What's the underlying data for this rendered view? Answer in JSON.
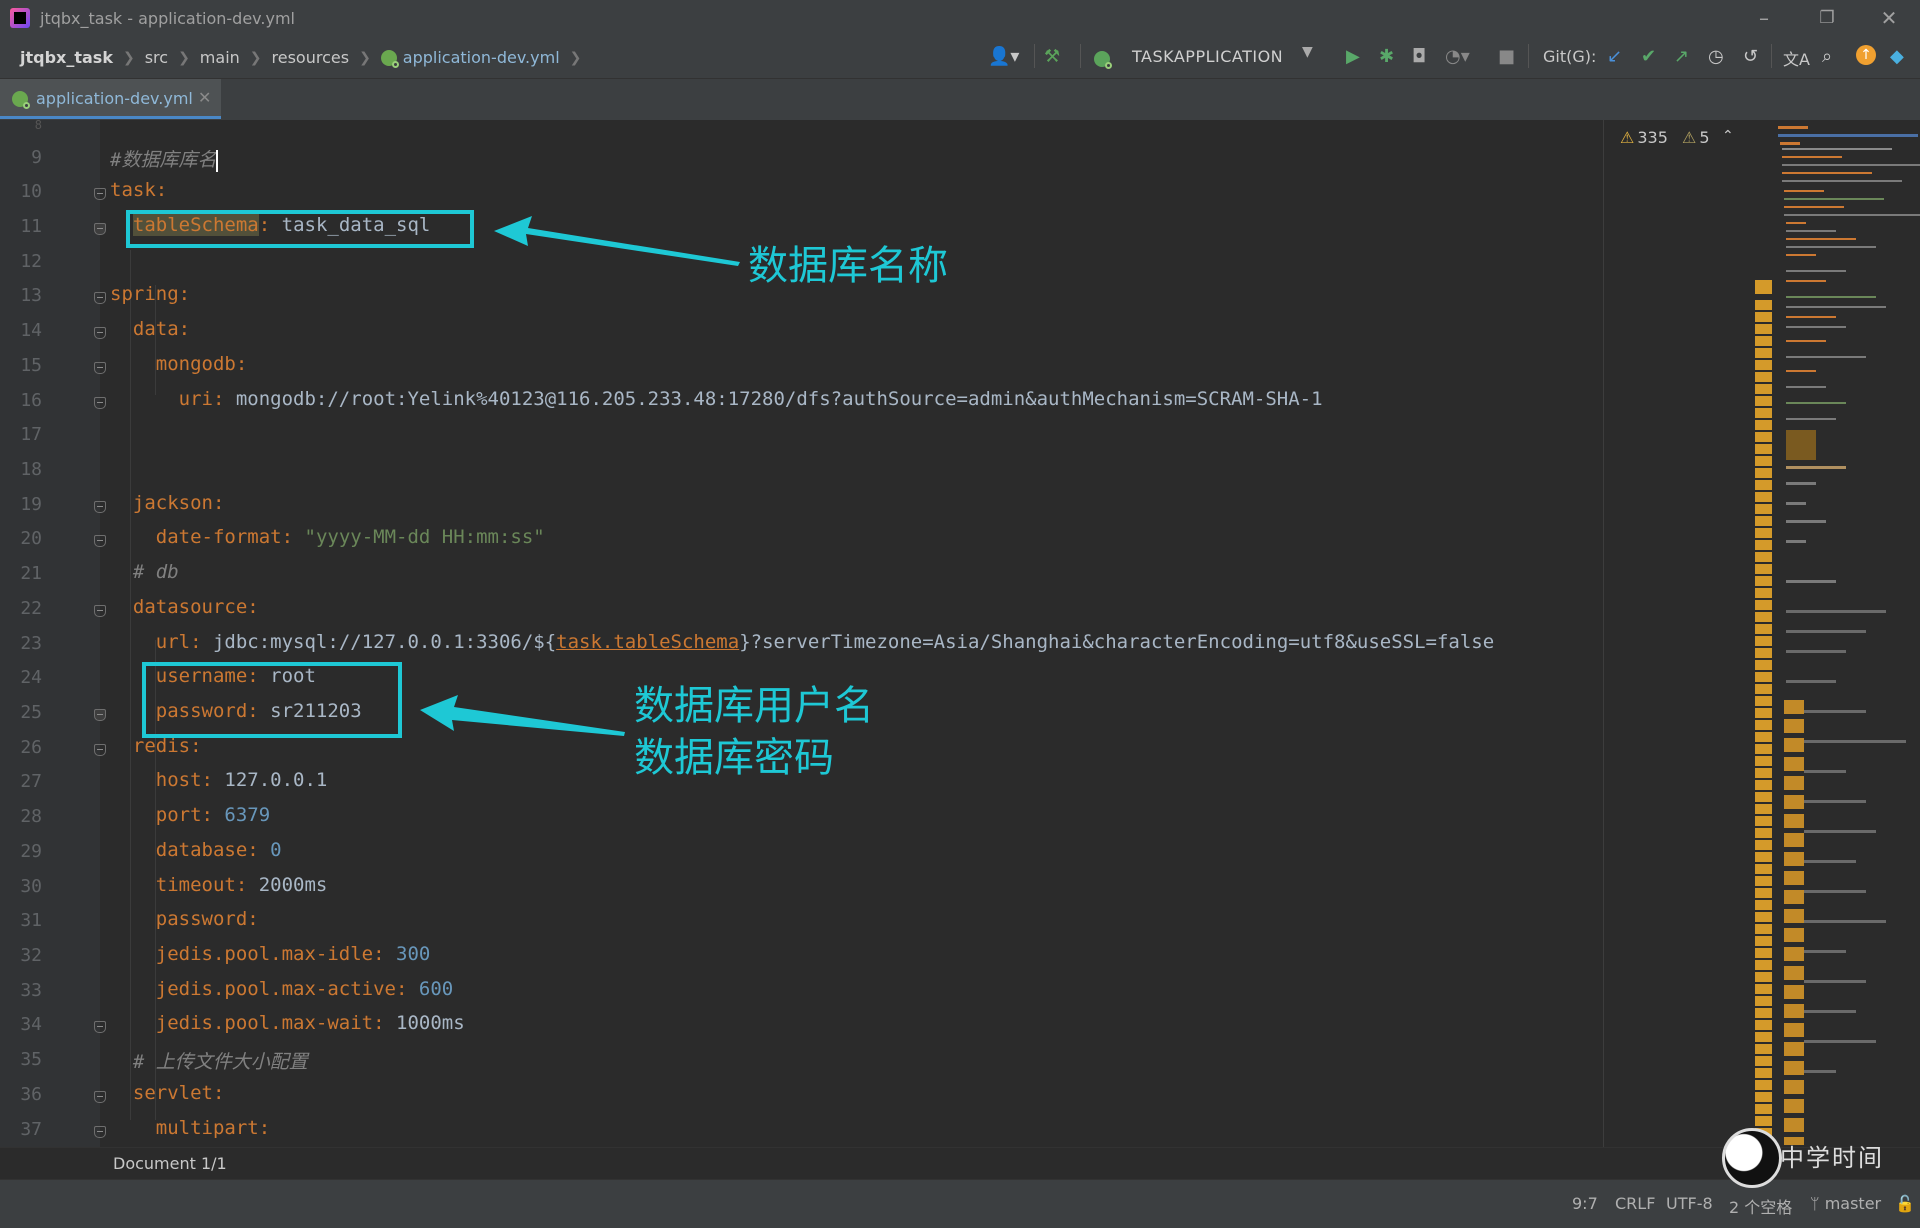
{
  "window": {
    "title": "jtqbx_task - application-dev.yml"
  },
  "breadcrumbs": [
    "jtqbx_task",
    "src",
    "main",
    "resources",
    "application-dev.yml"
  ],
  "toolbar": {
    "run_config": "TASKAPPLICATION",
    "git_label": "Git(G):"
  },
  "tab": {
    "label": "application-dev.yml"
  },
  "inspections": {
    "warnings": "335",
    "weak_warnings": "5"
  },
  "editor": {
    "line_numbers": [
      "9",
      "10",
      "11",
      "12",
      "13",
      "14",
      "15",
      "16",
      "17",
      "18",
      "19",
      "20",
      "21",
      "22",
      "23",
      "24",
      "25",
      "26",
      "27",
      "28",
      "29",
      "30",
      "31",
      "32",
      "33",
      "34",
      "35",
      "36",
      "37"
    ],
    "lines": {
      "l9": "#数据库库名",
      "l10_key": "task",
      "l11_key": "tableSchema",
      "l11_val": "task_data_sql",
      "l13_key": "spring",
      "l14_key": "data",
      "l15_key": "mongodb",
      "l16_key": "uri",
      "l16_val": "mongodb://root:Yelink%40123@116.205.233.48:17280/dfs?authSource=admin&authMechanism=SCRAM-SHA-1",
      "l19_key": "jackson",
      "l20_key": "date-format",
      "l20_val": "\"yyyy-MM-dd HH:mm:ss\"",
      "l21": "# db",
      "l22_key": "datasource",
      "l23_key": "url",
      "l23_val_a": "jdbc:mysql://127.0.0.1:3306/${",
      "l23_ref": "task.tableSchema",
      "l23_val_b": "}?serverTimezone=Asia/Shanghai&characterEncoding=utf8&useSSL=false",
      "l24_key": "username",
      "l24_val": "root",
      "l25_key": "password",
      "l25_val": "sr211203",
      "l26_key": "redis",
      "l27_key": "host",
      "l27_val": "127.0.0.1",
      "l28_key": "port",
      "l28_val": "6379",
      "l29_key": "database",
      "l29_val": "0",
      "l30_key": "timeout",
      "l30_val": "2000ms",
      "l31_key": "password",
      "l32_key": "jedis.pool.max-idle",
      "l32_val": "300",
      "l33_key": "jedis.pool.max-active",
      "l33_val": "600",
      "l34_key": "jedis.pool.max-wait",
      "l34_val": "1000ms",
      "l35": "# 上传文件大小配置",
      "l36_key": "servlet",
      "l37_key": "multipart"
    }
  },
  "annotations": {
    "db_name": "数据库名称",
    "db_user": "数据库用户名",
    "db_pass": "数据库密码",
    "color": "#1ec8d5"
  },
  "docbar": {
    "label": "Document 1/1"
  },
  "status": {
    "position": "9:7",
    "line_sep": "CRLF",
    "encoding": "UTF-8",
    "indent": "2 个空格",
    "branch": "master"
  },
  "watermark": {
    "text": "中学时间"
  }
}
